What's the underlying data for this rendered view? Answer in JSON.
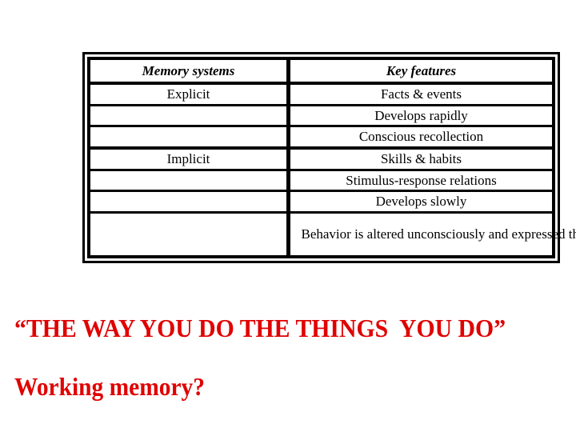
{
  "table": {
    "headers": {
      "memory_systems": "Memory systems",
      "key_features": "Key features"
    },
    "rows": [
      {
        "system": "Explicit",
        "feature": "Facts & events"
      },
      {
        "system": "",
        "feature": "Develops rapidly"
      },
      {
        "system": "",
        "feature": "Conscious recollection"
      },
      {
        "system": "Implicit",
        "feature": "Skills & habits"
      },
      {
        "system": "",
        "feature": "Stimulus-response relations"
      },
      {
        "system": "",
        "feature": "Develops slowly"
      },
      {
        "system": "",
        "feature": "Behavior is altered unconsciously and expressed through performance"
      }
    ]
  },
  "text": {
    "quote": "“THE WAY YOU DO THE THINGS  YOU DO”",
    "question": "Working memory?"
  },
  "colors": {
    "accent_red": "#e00000",
    "table_ink": "#000000"
  }
}
